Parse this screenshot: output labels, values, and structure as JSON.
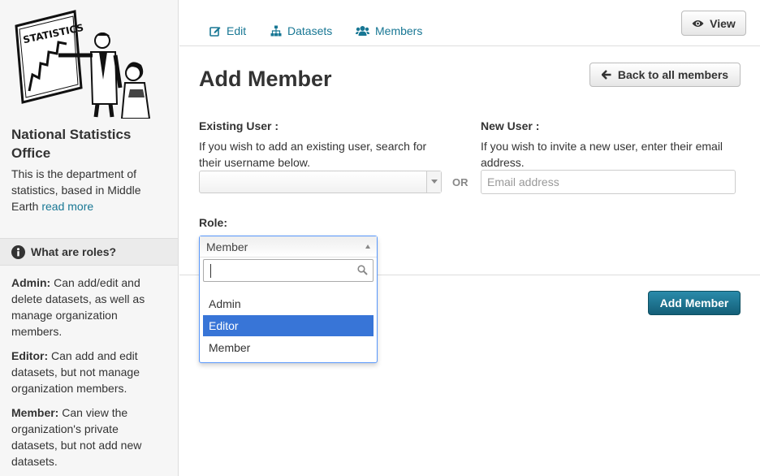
{
  "sidebar": {
    "org_title": "National Statistics Office",
    "org_description": "This is the department of statistics, based in Middle Earth",
    "read_more": "read more",
    "logo_text": "STATISTICS",
    "roles_heading": "What are roles?",
    "roles": [
      {
        "name": "Admin:",
        "desc": "Can add/edit and delete datasets, as well as manage organization members."
      },
      {
        "name": "Editor:",
        "desc": "Can add and edit datasets, but not manage organization members."
      },
      {
        "name": "Member:",
        "desc": "Can view the organization's private datasets, but not add new datasets."
      }
    ]
  },
  "nav": {
    "tabs": [
      {
        "label": "Edit",
        "icon": "edit-icon"
      },
      {
        "label": "Datasets",
        "icon": "sitemap-icon"
      },
      {
        "label": "Members",
        "icon": "group-icon"
      }
    ],
    "view_button": "View"
  },
  "main": {
    "title": "Add Member",
    "back_button": "Back to all members",
    "existing_user_label": "Existing User :",
    "existing_user_help": "If you wish to add an existing user, search for their username below.",
    "or_text": "OR",
    "new_user_label": "New User :",
    "new_user_help": "If you wish to invite a new user, enter their email address.",
    "email_placeholder": "Email address",
    "email_value": "",
    "role_label": "Role:",
    "role_selected": "Member",
    "role_options": [
      "Admin",
      "Editor",
      "Member"
    ],
    "role_highlighted": "Editor",
    "submit_button": "Add Member"
  },
  "colors": {
    "link": "#187794",
    "primary_button": "#1b6e8a",
    "highlight": "#3875d7"
  }
}
